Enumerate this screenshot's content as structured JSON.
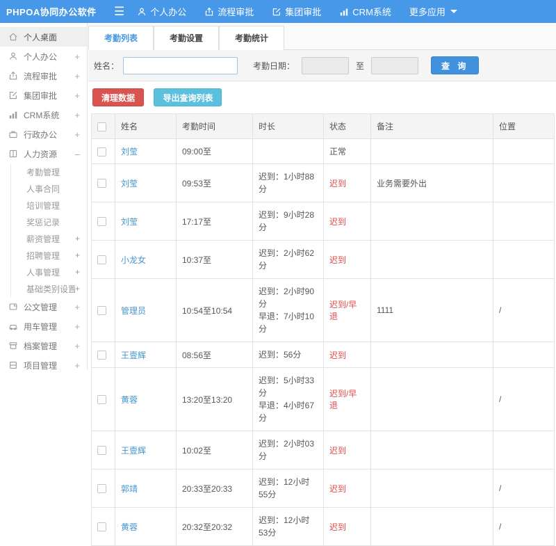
{
  "topnav": {
    "logo": "PHPOA协同办公软件",
    "hamburger_icon": "hamburger-icon",
    "items": [
      {
        "label": "个人办公",
        "icon": "user-icon"
      },
      {
        "label": "流程审批",
        "icon": "workflow-icon"
      },
      {
        "label": "集团审批",
        "icon": "approval-icon"
      },
      {
        "label": "CRM系统",
        "icon": "bar-chart-icon"
      },
      {
        "label": "更多应用",
        "icon": "caret-down-icon"
      }
    ],
    "bg_color": "#4798e8"
  },
  "sidebar": {
    "top": [
      {
        "label": "个人桌面",
        "icon": "home-icon",
        "expand": "",
        "active": true
      },
      {
        "label": "个人办公",
        "icon": "user-icon",
        "expand": "+"
      },
      {
        "label": "流程审批",
        "icon": "workflow-icon",
        "expand": "+"
      },
      {
        "label": "集团审批",
        "icon": "approval-icon",
        "expand": "+"
      },
      {
        "label": "CRM系统",
        "icon": "bar-chart-icon",
        "expand": "+"
      },
      {
        "label": "行政办公",
        "icon": "briefcase-icon",
        "expand": "+"
      },
      {
        "label": "人力资源",
        "icon": "book-icon",
        "expand": "–"
      }
    ],
    "submenu": [
      {
        "label": "考勤管理",
        "expand": ""
      },
      {
        "label": "人事合同",
        "expand": ""
      },
      {
        "label": "培训管理",
        "expand": ""
      },
      {
        "label": "奖惩记录",
        "expand": ""
      },
      {
        "label": "薪资管理",
        "expand": "+"
      },
      {
        "label": "招聘管理",
        "expand": "+"
      },
      {
        "label": "人事管理",
        "expand": "+"
      },
      {
        "label": "基础类别设置",
        "expand": "+"
      }
    ],
    "bottom": [
      {
        "label": "公文管理",
        "icon": "document-icon",
        "expand": "+"
      },
      {
        "label": "用车管理",
        "icon": "car-icon",
        "expand": "+"
      },
      {
        "label": "档案管理",
        "icon": "archive-icon",
        "expand": "+"
      },
      {
        "label": "项目管理",
        "icon": "folder-icon",
        "expand": "+"
      }
    ]
  },
  "tabs": [
    {
      "label": "考勤列表",
      "active": true
    },
    {
      "label": "考勤设置",
      "active": false
    },
    {
      "label": "考勤统计",
      "active": false
    }
  ],
  "filter": {
    "name_label": "姓名：",
    "name_value": "",
    "date_label": "考勤日期：",
    "date_from": "",
    "to_label": "至",
    "date_to": "",
    "search_label": "查 询"
  },
  "actions": {
    "clean_label": "清理数据",
    "export_label": "导出查询列表"
  },
  "table": {
    "headers": {
      "name": "姓名",
      "time": "考勤时间",
      "duration": "时长",
      "status": "状态",
      "remark": "备注",
      "location": "位置"
    },
    "status_colors": {
      "normal": "#555555",
      "late": "#e04b4b"
    },
    "rows": [
      {
        "name": "刘莹",
        "time": "09:00至",
        "duration": "",
        "status": "正常",
        "status_color": "#555555",
        "remark": "",
        "location": ""
      },
      {
        "name": "刘莹",
        "time": "09:53至",
        "duration": "迟到：1小时88分",
        "status": "迟到",
        "status_color": "#e04b4b",
        "remark": "业务需要外出",
        "location": ""
      },
      {
        "name": "刘莹",
        "time": "17:17至",
        "duration": "迟到：9小时28分",
        "status": "迟到",
        "status_color": "#e04b4b",
        "remark": "",
        "location": ""
      },
      {
        "name": "小龙女",
        "time": "10:37至",
        "duration": "迟到：2小时62分",
        "status": "迟到",
        "status_color": "#e04b4b",
        "remark": "",
        "location": ""
      },
      {
        "name": "管理员",
        "time": "10:54至10:54",
        "duration": "迟到：2小时90分\n早退：7小时10分",
        "status": "迟到/早退",
        "status_color": "#e04b4b",
        "remark": "1111",
        "location": "/"
      },
      {
        "name": "王壹辉",
        "time": "08:56至",
        "duration": "迟到：56分",
        "status": "迟到",
        "status_color": "#e04b4b",
        "remark": "",
        "location": ""
      },
      {
        "name": "黄蓉",
        "time": "13:20至13:20",
        "duration": "迟到：5小时33分\n早退：4小时67分",
        "status": "迟到/早退",
        "status_color": "#e04b4b",
        "remark": "",
        "location": "/"
      },
      {
        "name": "王壹辉",
        "time": "10:02至",
        "duration": "迟到：2小时03分",
        "status": "迟到",
        "status_color": "#e04b4b",
        "remark": "",
        "location": ""
      },
      {
        "name": "郭靖",
        "time": "20:33至20:33",
        "duration": "迟到：12小时55分",
        "status": "迟到",
        "status_color": "#e04b4b",
        "remark": "",
        "location": "/"
      },
      {
        "name": "黄蓉",
        "time": "20:32至20:32",
        "duration": "迟到：12小时53分",
        "status": "迟到",
        "status_color": "#e04b4b",
        "remark": "",
        "location": "/"
      }
    ]
  }
}
